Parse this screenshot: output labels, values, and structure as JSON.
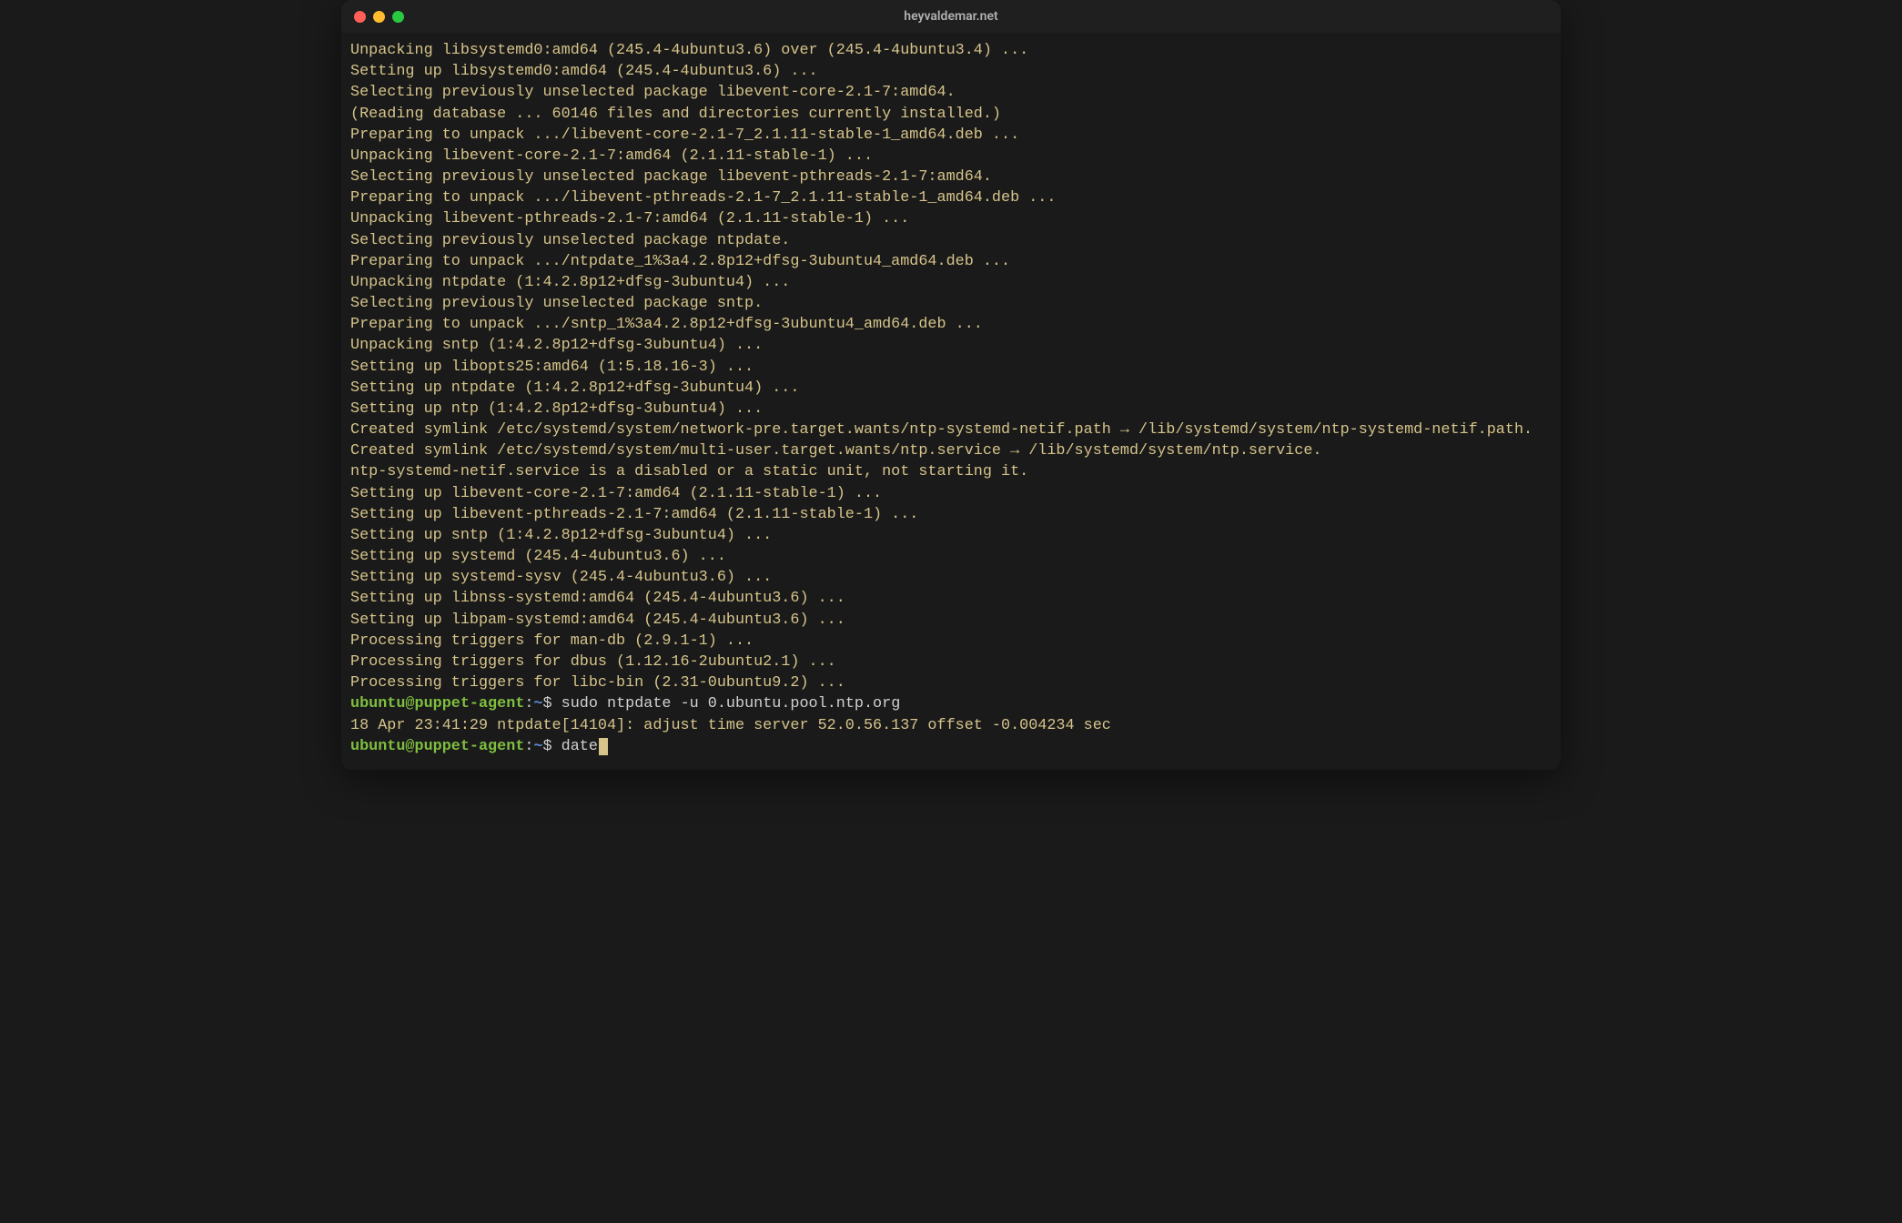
{
  "window": {
    "title": "heyvaldemar.net"
  },
  "prompt": {
    "user_host": "ubuntu@puppet-agent",
    "sep1": ":",
    "path": "~",
    "sep2": "$ "
  },
  "output_lines": [
    "Unpacking libsystemd0:amd64 (245.4-4ubuntu3.6) over (245.4-4ubuntu3.4) ...",
    "Setting up libsystemd0:amd64 (245.4-4ubuntu3.6) ...",
    "Selecting previously unselected package libevent-core-2.1-7:amd64.",
    "(Reading database ... 60146 files and directories currently installed.)",
    "Preparing to unpack .../libevent-core-2.1-7_2.1.11-stable-1_amd64.deb ...",
    "Unpacking libevent-core-2.1-7:amd64 (2.1.11-stable-1) ...",
    "Selecting previously unselected package libevent-pthreads-2.1-7:amd64.",
    "Preparing to unpack .../libevent-pthreads-2.1-7_2.1.11-stable-1_amd64.deb ...",
    "Unpacking libevent-pthreads-2.1-7:amd64 (2.1.11-stable-1) ...",
    "Selecting previously unselected package ntpdate.",
    "Preparing to unpack .../ntpdate_1%3a4.2.8p12+dfsg-3ubuntu4_amd64.deb ...",
    "Unpacking ntpdate (1:4.2.8p12+dfsg-3ubuntu4) ...",
    "Selecting previously unselected package sntp.",
    "Preparing to unpack .../sntp_1%3a4.2.8p12+dfsg-3ubuntu4_amd64.deb ...",
    "Unpacking sntp (1:4.2.8p12+dfsg-3ubuntu4) ...",
    "Setting up libopts25:amd64 (1:5.18.16-3) ...",
    "Setting up ntpdate (1:4.2.8p12+dfsg-3ubuntu4) ...",
    "Setting up ntp (1:4.2.8p12+dfsg-3ubuntu4) ...",
    "Created symlink /etc/systemd/system/network-pre.target.wants/ntp-systemd-netif.path → /lib/systemd/system/ntp-systemd-netif.path.",
    "Created symlink /etc/systemd/system/multi-user.target.wants/ntp.service → /lib/systemd/system/ntp.service.",
    "ntp-systemd-netif.service is a disabled or a static unit, not starting it.",
    "Setting up libevent-core-2.1-7:amd64 (2.1.11-stable-1) ...",
    "Setting up libevent-pthreads-2.1-7:amd64 (2.1.11-stable-1) ...",
    "Setting up sntp (1:4.2.8p12+dfsg-3ubuntu4) ...",
    "Setting up systemd (245.4-4ubuntu3.6) ...",
    "Setting up systemd-sysv (245.4-4ubuntu3.6) ...",
    "Setting up libnss-systemd:amd64 (245.4-4ubuntu3.6) ...",
    "Setting up libpam-systemd:amd64 (245.4-4ubuntu3.6) ...",
    "Processing triggers for man-db (2.9.1-1) ...",
    "Processing triggers for dbus (1.12.16-2ubuntu2.1) ...",
    "Processing triggers for libc-bin (2.31-0ubuntu9.2) ..."
  ],
  "commands": [
    {
      "cmd": "sudo ntpdate -u 0.ubuntu.pool.ntp.org",
      "response": "18 Apr 23:41:29 ntpdate[14104]: adjust time server 52.0.56.137 offset -0.004234 sec"
    },
    {
      "cmd": "date",
      "response": null
    }
  ]
}
